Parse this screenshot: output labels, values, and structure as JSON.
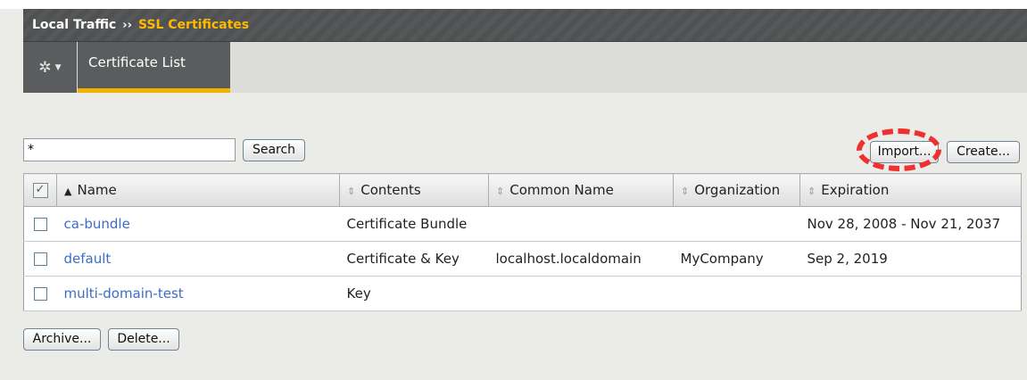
{
  "breadcrumb": {
    "section": "Local Traffic",
    "separator": "››",
    "current": "SSL Certificates"
  },
  "tabs": {
    "gear_icon": "gear-icon",
    "active_tab": "Certificate List"
  },
  "search": {
    "value": "*",
    "button_label": "Search"
  },
  "actions": {
    "import_label": "Import...",
    "create_label": "Create...",
    "archive_label": "Archive...",
    "delete_label": "Delete..."
  },
  "table": {
    "columns": [
      "Name",
      "Contents",
      "Common Name",
      "Organization",
      "Expiration"
    ],
    "rows": [
      {
        "name": "ca-bundle",
        "contents": "Certificate Bundle",
        "common_name": "",
        "organization": "",
        "expiration": "Nov 28, 2008 - Nov 21, 2037"
      },
      {
        "name": "default",
        "contents": "Certificate & Key",
        "common_name": "localhost.localdomain",
        "organization": "MyCompany",
        "expiration": "Sep 2, 2019"
      },
      {
        "name": "multi-domain-test",
        "contents": "Key",
        "common_name": "",
        "organization": "",
        "expiration": ""
      }
    ]
  },
  "colors": {
    "header_bg": "#4f5152",
    "breadcrumb_accent": "#ffb900",
    "tab_underline": "#f0b400",
    "link": "#3d6dc7",
    "highlight_ring": "#ef3030"
  }
}
